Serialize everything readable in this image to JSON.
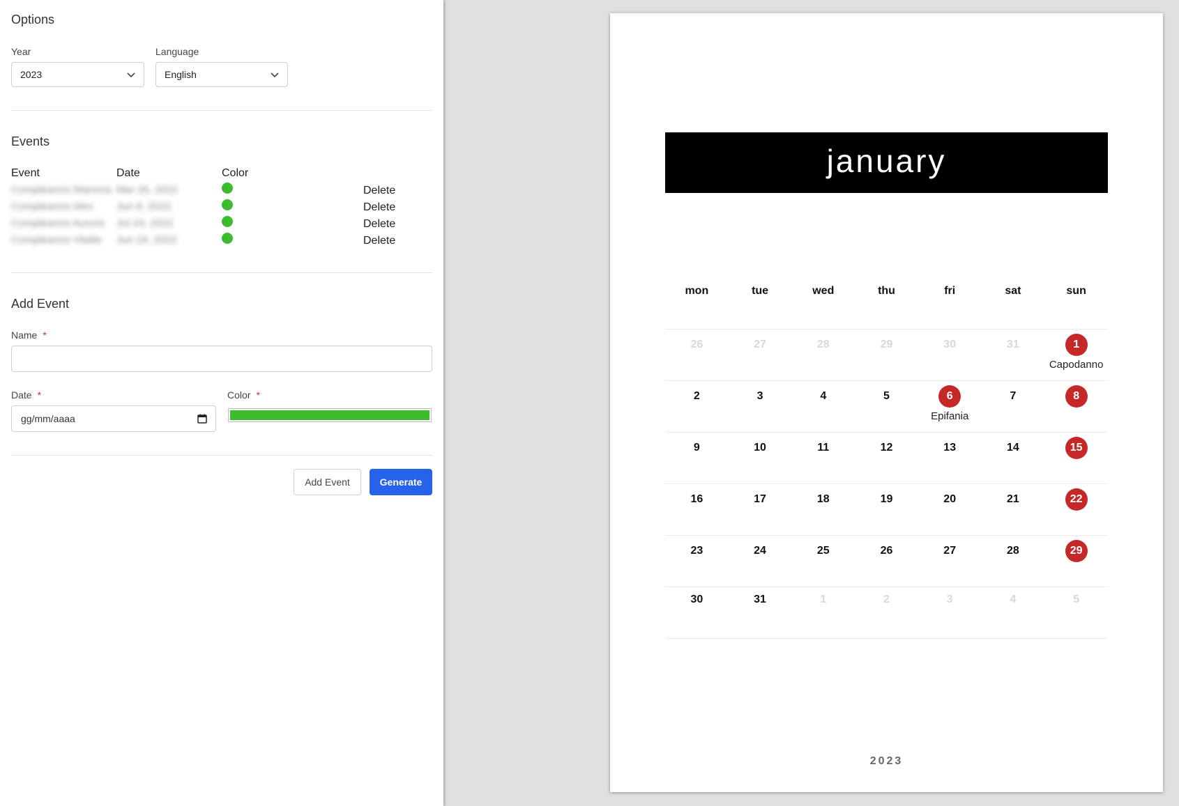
{
  "options": {
    "title": "Options",
    "year_label": "Year",
    "year_value": "2023",
    "language_label": "Language",
    "language_value": "English"
  },
  "events": {
    "title": "Events",
    "headers": {
      "event": "Event",
      "date": "Date",
      "color": "Color"
    },
    "rows": [
      {
        "name": "Compleanno Mamma",
        "date": "Mar 26, 2022",
        "color": "#3dbb2f",
        "action": "Delete"
      },
      {
        "name": "Compleanno Alex",
        "date": "Jun 8, 2022",
        "color": "#3dbb2f",
        "action": "Delete"
      },
      {
        "name": "Compleanno Aurora",
        "date": "Jul 24, 2022",
        "color": "#3dbb2f",
        "action": "Delete"
      },
      {
        "name": "Compleanno Vitalie",
        "date": "Jun 16, 2022",
        "color": "#3dbb2f",
        "action": "Delete"
      }
    ]
  },
  "add_event": {
    "title": "Add Event",
    "name_label": "Name",
    "name_value": "",
    "required_mark": "*",
    "date_label": "Date",
    "date_placeholder": "gg/mm/aaaa",
    "color_label": "Color",
    "color_value": "#3dbb2f",
    "add_button": "Add Event",
    "generate_button": "Generate"
  },
  "calendar": {
    "month": "january",
    "year": "2023",
    "weekdays": [
      "mon",
      "tue",
      "wed",
      "thu",
      "fri",
      "sat",
      "sun"
    ],
    "weeks": [
      [
        {
          "d": "26",
          "muted": true
        },
        {
          "d": "27",
          "muted": true
        },
        {
          "d": "28",
          "muted": true
        },
        {
          "d": "29",
          "muted": true
        },
        {
          "d": "30",
          "muted": true
        },
        {
          "d": "31",
          "muted": true
        },
        {
          "d": "1",
          "holiday": true,
          "label": "Capodanno"
        }
      ],
      [
        {
          "d": "2"
        },
        {
          "d": "3"
        },
        {
          "d": "4"
        },
        {
          "d": "5"
        },
        {
          "d": "6",
          "holiday": true,
          "label": "Epifania"
        },
        {
          "d": "7"
        },
        {
          "d": "8",
          "holiday": true
        }
      ],
      [
        {
          "d": "9"
        },
        {
          "d": "10"
        },
        {
          "d": "11"
        },
        {
          "d": "12"
        },
        {
          "d": "13"
        },
        {
          "d": "14"
        },
        {
          "d": "15",
          "holiday": true
        }
      ],
      [
        {
          "d": "16"
        },
        {
          "d": "17"
        },
        {
          "d": "18"
        },
        {
          "d": "19"
        },
        {
          "d": "20"
        },
        {
          "d": "21"
        },
        {
          "d": "22",
          "holiday": true
        }
      ],
      [
        {
          "d": "23"
        },
        {
          "d": "24"
        },
        {
          "d": "25"
        },
        {
          "d": "26"
        },
        {
          "d": "27"
        },
        {
          "d": "28"
        },
        {
          "d": "29",
          "holiday": true
        }
      ],
      [
        {
          "d": "30"
        },
        {
          "d": "31"
        },
        {
          "d": "1",
          "muted": true
        },
        {
          "d": "2",
          "muted": true
        },
        {
          "d": "3",
          "muted": true
        },
        {
          "d": "4",
          "muted": true
        },
        {
          "d": "5",
          "muted": true
        }
      ]
    ],
    "holiday_color": "#c62828"
  }
}
